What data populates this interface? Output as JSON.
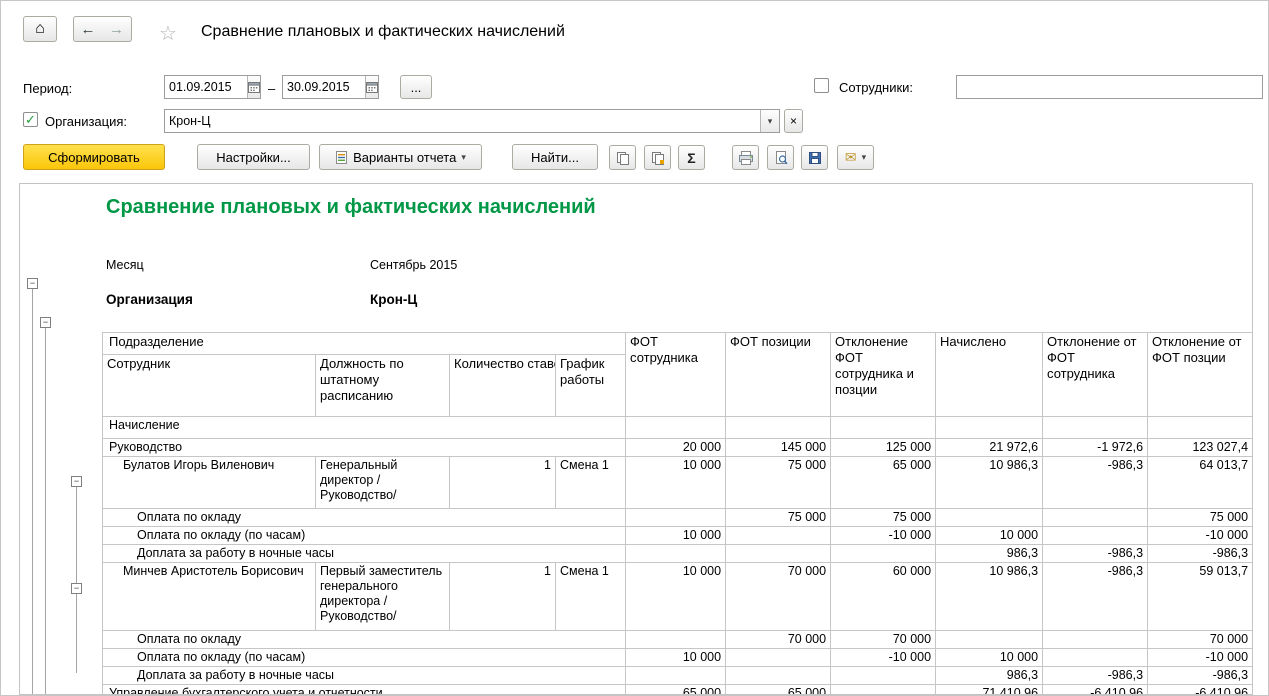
{
  "window": {
    "title": "Сравнение плановых и фактических начислений"
  },
  "icons": {
    "home": "⌂",
    "back": "←",
    "forward": "→",
    "star": "☆",
    "dropdown": "▾",
    "clear": "×",
    "check": "✓",
    "sigma": "Σ",
    "collapse": "−",
    "envelope": "✉"
  },
  "filters": {
    "period_label": "Период:",
    "date_from": "01.09.2015",
    "date_to": "30.09.2015",
    "range_dash": "–",
    "more_button": "...",
    "employees_label": "Сотрудники:",
    "employees_value": "",
    "organization_label": "Организация:",
    "organization_value": "Крон-Ц"
  },
  "toolbar": {
    "generate": "Сформировать",
    "settings": "Настройки...",
    "variants": "Варианты отчета",
    "find": "Найти..."
  },
  "report": {
    "title": "Сравнение плановых и фактических начислений",
    "month_label": "Месяц",
    "month_value": "Сентябрь 2015",
    "organization_label": "Организация",
    "organization_value": "Крон-Ц",
    "table": {
      "headers": {
        "department": "Подразделение",
        "employee": "Сотрудник",
        "position": "Должность по штатному расписанию",
        "rate": "Количество ставок",
        "schedule": "График работы",
        "fot_employee": "ФОТ сотрудника",
        "fot_position": "ФОТ позиции",
        "deviation_fot": "Отклонение ФОТ сотрудника и позции",
        "accrued": "Начислено",
        "dev_from_fot_employee": "Отклонение от ФОТ сотрудника",
        "dev_from_fot_position": "Отклонение от ФОТ позции"
      },
      "section_label": "Начисление",
      "rows": [
        {
          "label": "Руководство",
          "v": [
            "20 000",
            "145 000",
            "125 000",
            "21 972,6",
            "-1 972,6",
            "123 027,4"
          ]
        },
        {
          "name": "Булатов Игорь Виленович",
          "position": "Генеральный директор /Руководство/",
          "rate": "1",
          "schedule": "Смена 1",
          "v": [
            "10 000",
            "75 000",
            "65 000",
            "10 986,3",
            "-986,3",
            "64 013,7"
          ]
        },
        {
          "label": "Оплата по окладу",
          "v": [
            "",
            "75 000",
            "75 000",
            "",
            "",
            "75 000"
          ]
        },
        {
          "label": "Оплата по окладу (по часам)",
          "v": [
            "10 000",
            "",
            "-10 000",
            "10 000",
            "",
            "-10 000"
          ]
        },
        {
          "label": "Доплата за работу в ночные часы",
          "v": [
            "",
            "",
            "",
            "986,3",
            "-986,3",
            "-986,3"
          ]
        },
        {
          "name": "Минчев Аристотель Борисович",
          "position": "Первый заместитель генерального директора /Руководство/",
          "rate": "1",
          "schedule": "Смена 1",
          "v": [
            "10 000",
            "70 000",
            "60 000",
            "10 986,3",
            "-986,3",
            "59 013,7"
          ]
        },
        {
          "label": "Оплата по окладу",
          "v": [
            "",
            "70 000",
            "70 000",
            "",
            "",
            "70 000"
          ]
        },
        {
          "label": "Оплата по окладу (по часам)",
          "v": [
            "10 000",
            "",
            "-10 000",
            "10 000",
            "",
            "-10 000"
          ]
        },
        {
          "label": "Доплата за работу в ночные часы",
          "v": [
            "",
            "",
            "",
            "986,3",
            "-986,3",
            "-986,3"
          ]
        },
        {
          "label": "Управление бухгалтерского учета и отчетности",
          "v": [
            "65 000",
            "65 000",
            "",
            "71 410,96",
            "-6 410,96",
            "-6 410,96"
          ]
        }
      ]
    }
  }
}
